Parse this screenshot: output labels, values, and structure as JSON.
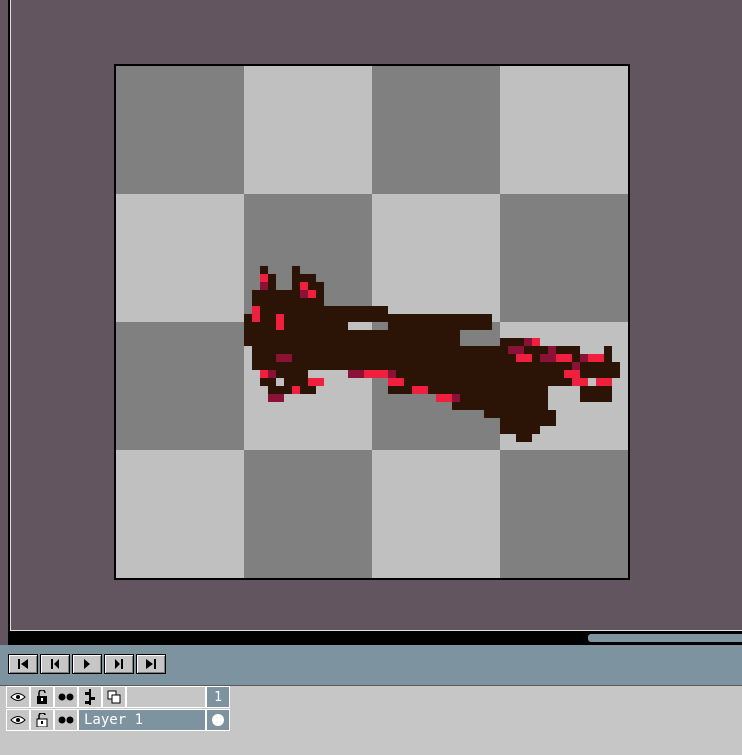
{
  "canvas": {
    "checker_dark": "#808080",
    "checker_light": "#c0c0c0",
    "sprite_dark": "#2b1306",
    "sprite_red": "#ef1f3d",
    "sprite_maroon": "#8a1236"
  },
  "colors": {
    "workspace": "#635560",
    "panel": "#c6c6c6",
    "accent": "#7e93a0"
  },
  "animation_controls": {
    "buttons": [
      "first-frame-icon",
      "previous-frame-icon",
      "play-icon",
      "next-frame-icon",
      "last-frame-icon"
    ]
  },
  "layers": {
    "header": {
      "icons": [
        "eye-icon",
        "lock-icon",
        "onion-skin-icon",
        "link-icon",
        "copy-icon"
      ],
      "frame_number": "1"
    },
    "items": [
      {
        "name": "Layer 1"
      }
    ]
  }
}
